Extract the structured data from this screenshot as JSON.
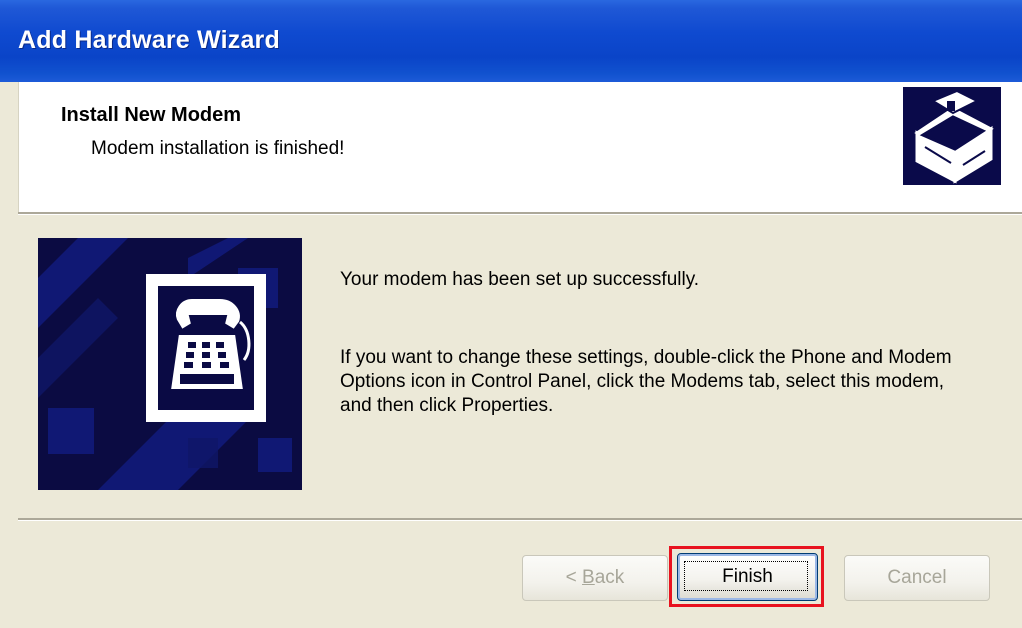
{
  "window": {
    "title": "Add Hardware Wizard"
  },
  "header": {
    "title": "Install New Modem",
    "subtitle": "Modem installation is finished!",
    "icon": "hardware-box-icon"
  },
  "body": {
    "art_icon": "telephone-icon",
    "message_success": "Your modem has been set up successfully.",
    "message_instructions": "If you want to change these settings, double-click the Phone and Modem Options icon in Control Panel, click the Modems tab, select this modem, and then click Properties."
  },
  "buttons": {
    "back_prefix": "< ",
    "back_accel": "B",
    "back_rest": "ack",
    "finish": "Finish",
    "cancel": "Cancel"
  },
  "colors": {
    "titlebar": "#0a44c8",
    "dialog_bg": "#ece9d8",
    "art_bg": "#0a0a44",
    "highlight": "#e8121f"
  }
}
